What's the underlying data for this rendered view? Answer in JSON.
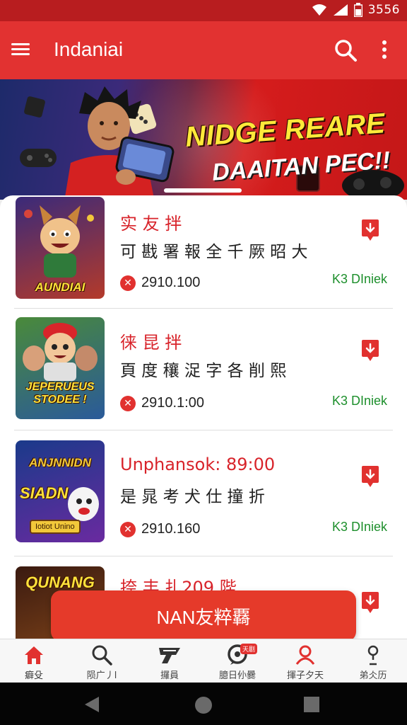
{
  "status_bar": {
    "time": "3556"
  },
  "app_bar": {
    "title": "Indaniai"
  },
  "banner": {
    "headline_line1": "NIDGE REARE",
    "headline_line2": "DAAITAN PEC!!"
  },
  "games": [
    {
      "thumb_text": "AUNDIAI",
      "name": "实 友 拌",
      "description": "可 戡 署 報 全 千 厥 昭 大",
      "price": "2910.100",
      "status": "K3 DIniek"
    },
    {
      "thumb_text": "JEPERUEUS STODEE !",
      "name": "徕 昆 拌",
      "description": "頁 度 穰 浞 字 各 削 熙",
      "price": "2910.1:00",
      "status": "K3 DIniek"
    },
    {
      "thumb_text": "SIADN",
      "thumb_text_top": "ANJNNIDN",
      "thumb_tag": "Iotiot Unino",
      "name": "Unphansok: 89:00",
      "description": "是 晁 考 犬 仕 撞 折",
      "price": "2910.160",
      "status": "K3 DIniek"
    },
    {
      "thumb_text": "QUNANG",
      "name": "捺 丰 扎209 陛",
      "description": "",
      "price": "",
      "status": ""
    }
  ],
  "cta": {
    "label": "NAN友粹覉"
  },
  "bottom_nav": [
    {
      "label": "癖殳",
      "icon": "home-icon"
    },
    {
      "label": "陨广丿l",
      "icon": "search-icon"
    },
    {
      "label": "攞員",
      "icon": "ranking-icon"
    },
    {
      "label": "臆日仦爨",
      "icon": "chat-icon",
      "badge": "天剧"
    },
    {
      "label": "揮子夕天",
      "icon": "profile-icon"
    },
    {
      "label": "弟仌历",
      "icon": "user-icon"
    }
  ],
  "colors": {
    "primary": "#e23231",
    "status_bar": "#b81d1f",
    "price_icon": "#e1312f",
    "status_green": "#1d8f2c"
  }
}
